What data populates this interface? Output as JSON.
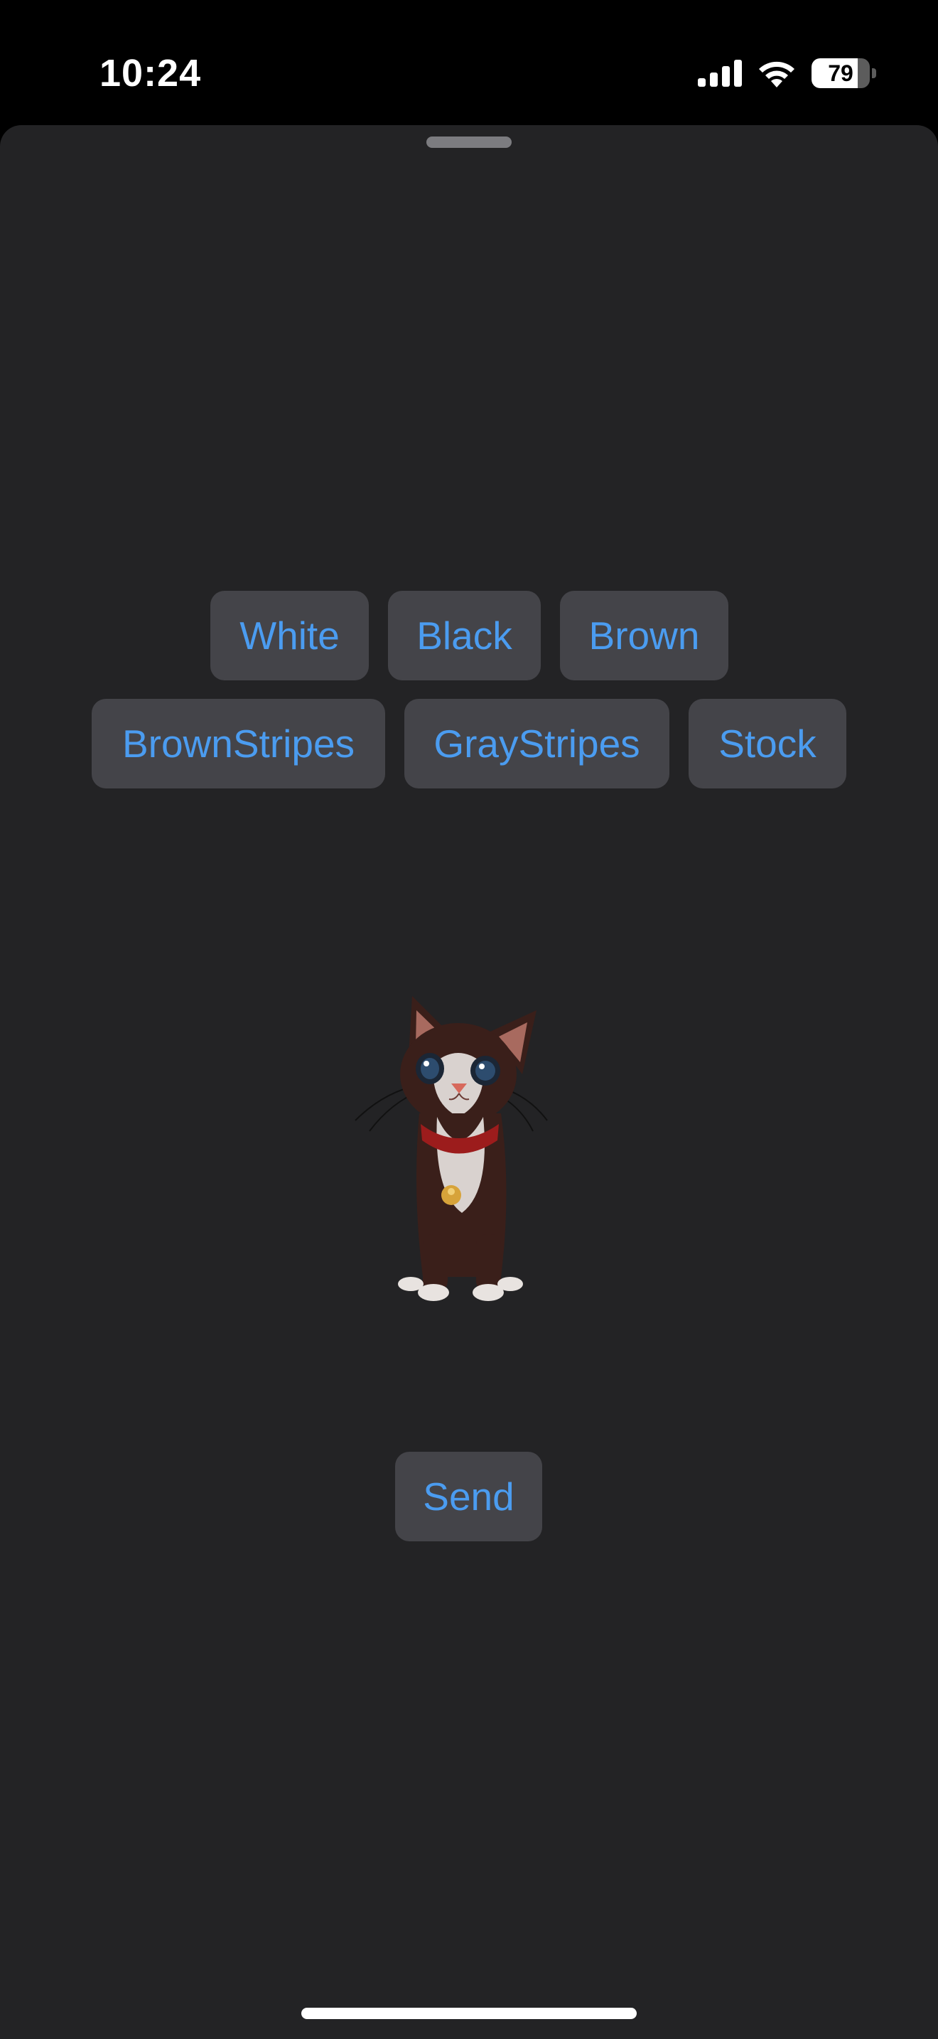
{
  "status_bar": {
    "time": "10:24",
    "battery_level": "79",
    "battery_fraction": 0.79,
    "icons": [
      "cellular-signal-icon",
      "wifi-icon",
      "battery-icon"
    ]
  },
  "color_buttons": {
    "row1": [
      "White",
      "Black",
      "Brown"
    ],
    "row2": [
      "BrownStripes",
      "GrayStripes",
      "Stock"
    ]
  },
  "preview": {
    "image": "cat-3d-model"
  },
  "send_label": "Send",
  "colors": {
    "background": "#000000",
    "sheet": "#232325",
    "button_fill": "#444449",
    "accent": "#4b9cf0"
  }
}
